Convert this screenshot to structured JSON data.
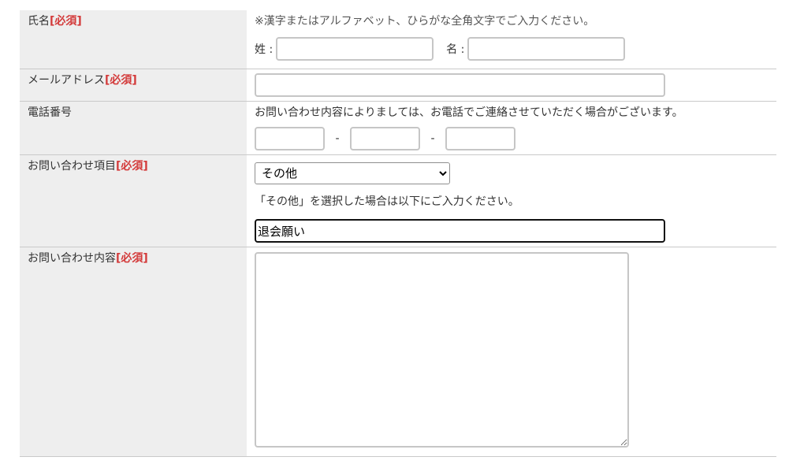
{
  "required_mark": "[必須]",
  "name": {
    "label": "氏名",
    "note": "※漢字またはアルファベット、ひらがな全角文字でご入力ください。",
    "last_label": "姓 :",
    "first_label": "名 :",
    "last_value": "",
    "first_value": ""
  },
  "email": {
    "label": "メールアドレス",
    "value": ""
  },
  "phone": {
    "label": "電話番号",
    "note": "お問い合わせ内容によりましては、お電話でご連絡させていただく場合がございます。",
    "separator": "-",
    "part1": "",
    "part2": "",
    "part3": ""
  },
  "category": {
    "label": "お問い合わせ項目",
    "selected": "その他",
    "note": "「その他」を選択した場合は以下にご入力ください。",
    "other_value": "退会願い"
  },
  "message": {
    "label": "お問い合わせ内容",
    "value": ""
  }
}
